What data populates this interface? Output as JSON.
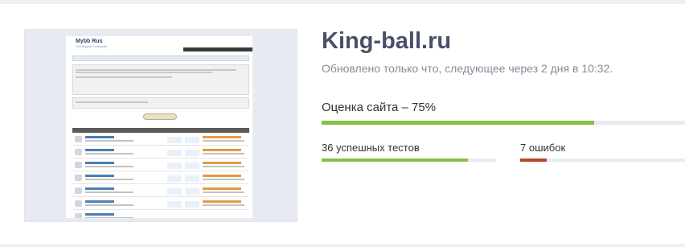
{
  "site": {
    "title": "King-ball.ru",
    "updated_text": "Обновлено только что, следующее через 2 дня в 10:32."
  },
  "score": {
    "label": "Оценка сайта – 75%",
    "value_percent": 75,
    "color": "#87bf47"
  },
  "tests": {
    "passed_label": "36 успешных тестов",
    "passed_count": 36,
    "errors_label": "7 ошибок",
    "errors_count": 7,
    "passed_color": "#87bf47",
    "errors_color": "#b9452c"
  },
  "thumbnail": {
    "logo_text": "Mybb Rus",
    "logo_subtext": "Your Support Community"
  }
}
